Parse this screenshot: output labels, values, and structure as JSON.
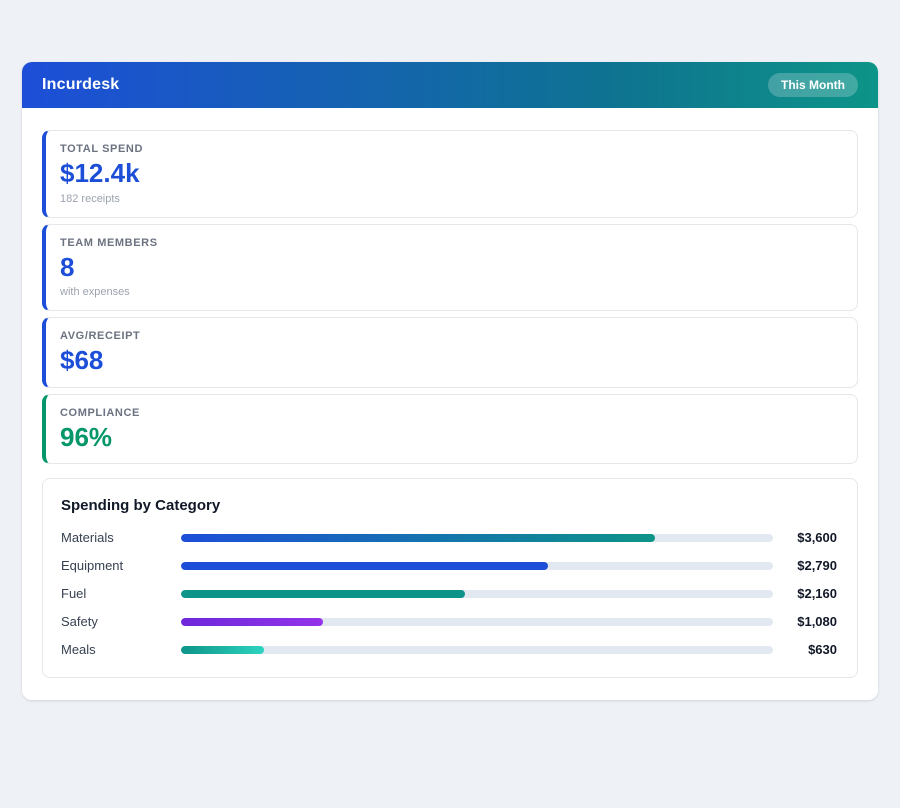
{
  "header": {
    "title": "Incurdesk",
    "period_badge": "This Month"
  },
  "colors": {
    "header_gradient_start": "#1d4ed8",
    "header_gradient_end": "#0d9488",
    "blue_accent": "#1d4ed8",
    "green_accent": "#059669",
    "track": "#e2e8f0"
  },
  "stats": [
    {
      "label": "TOTAL SPEND",
      "value": "$12.4k",
      "sub": "182 receipts",
      "accent": "#1d4ed8"
    },
    {
      "label": "TEAM MEMBERS",
      "value": "8",
      "sub": "with expenses",
      "accent": "#1d4ed8"
    },
    {
      "label": "AVG/RECEIPT",
      "value": "$68",
      "sub": "",
      "accent": "#1d4ed8"
    },
    {
      "label": "COMPLIANCE",
      "value": "96%",
      "sub": "",
      "accent": "#059669"
    }
  ],
  "chart_data": {
    "type": "bar",
    "title": "Spending by Category",
    "categories": [
      "Materials",
      "Equipment",
      "Fuel",
      "Safety",
      "Meals"
    ],
    "values": [
      3600,
      2790,
      2160,
      1080,
      630
    ],
    "value_labels": [
      "$3,600",
      "$2,790",
      "$2,160",
      "$1,080",
      "$630"
    ],
    "xlim": [
      0,
      4500
    ],
    "orientation": "horizontal",
    "bar_colors": [
      "linear-gradient(90deg, #1d4ed8, #0d9488)",
      "#1d4ed8",
      "#0d9488",
      "linear-gradient(90deg, #6d28d9, #9333ea)",
      "linear-gradient(90deg, #0d9488, #2dd4bf)"
    ]
  }
}
